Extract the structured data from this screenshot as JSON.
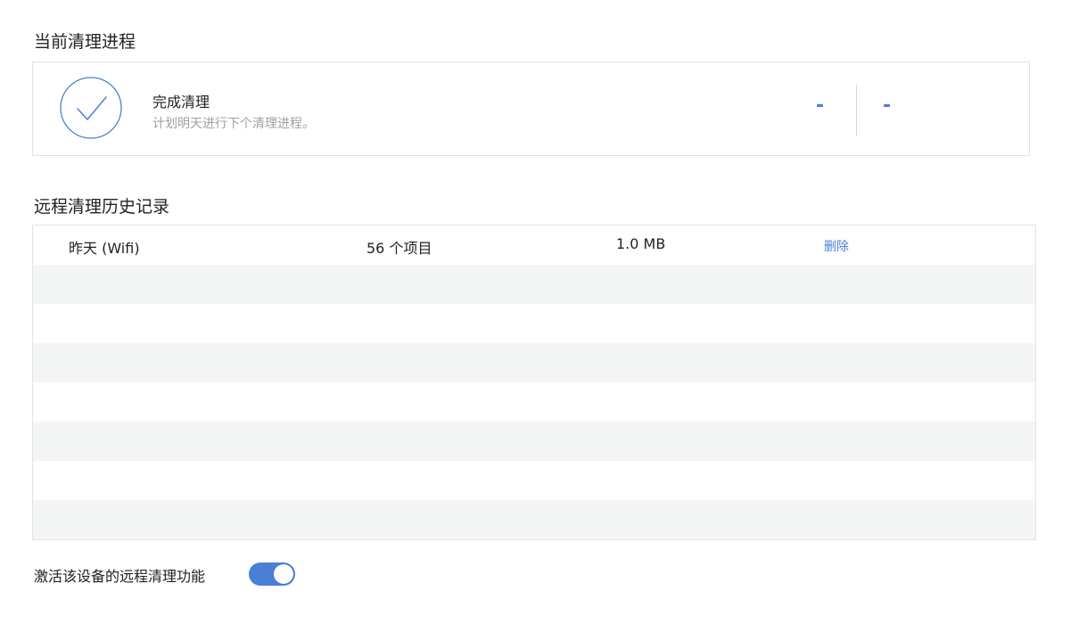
{
  "current_cleanup": {
    "title": "当前清理进程",
    "status_title": "完成清理",
    "status_subtitle": "计划明天进行下个清理进程。",
    "stat_left": "-",
    "stat_right": "-",
    "icon": "check-circle-icon"
  },
  "history": {
    "title": "远程清理历史记录",
    "rows": [
      {
        "date": "昨天 (Wifi)",
        "items": "56 个项目",
        "size": "1.0 MB",
        "action": "删除"
      }
    ]
  },
  "remote_toggle": {
    "label": "激活该设备的远程清理功能",
    "enabled": true
  },
  "colors": {
    "accent": "#4a7fd6",
    "row_alt": "#f4f5f5",
    "muted_text": "#a0a0a0"
  }
}
